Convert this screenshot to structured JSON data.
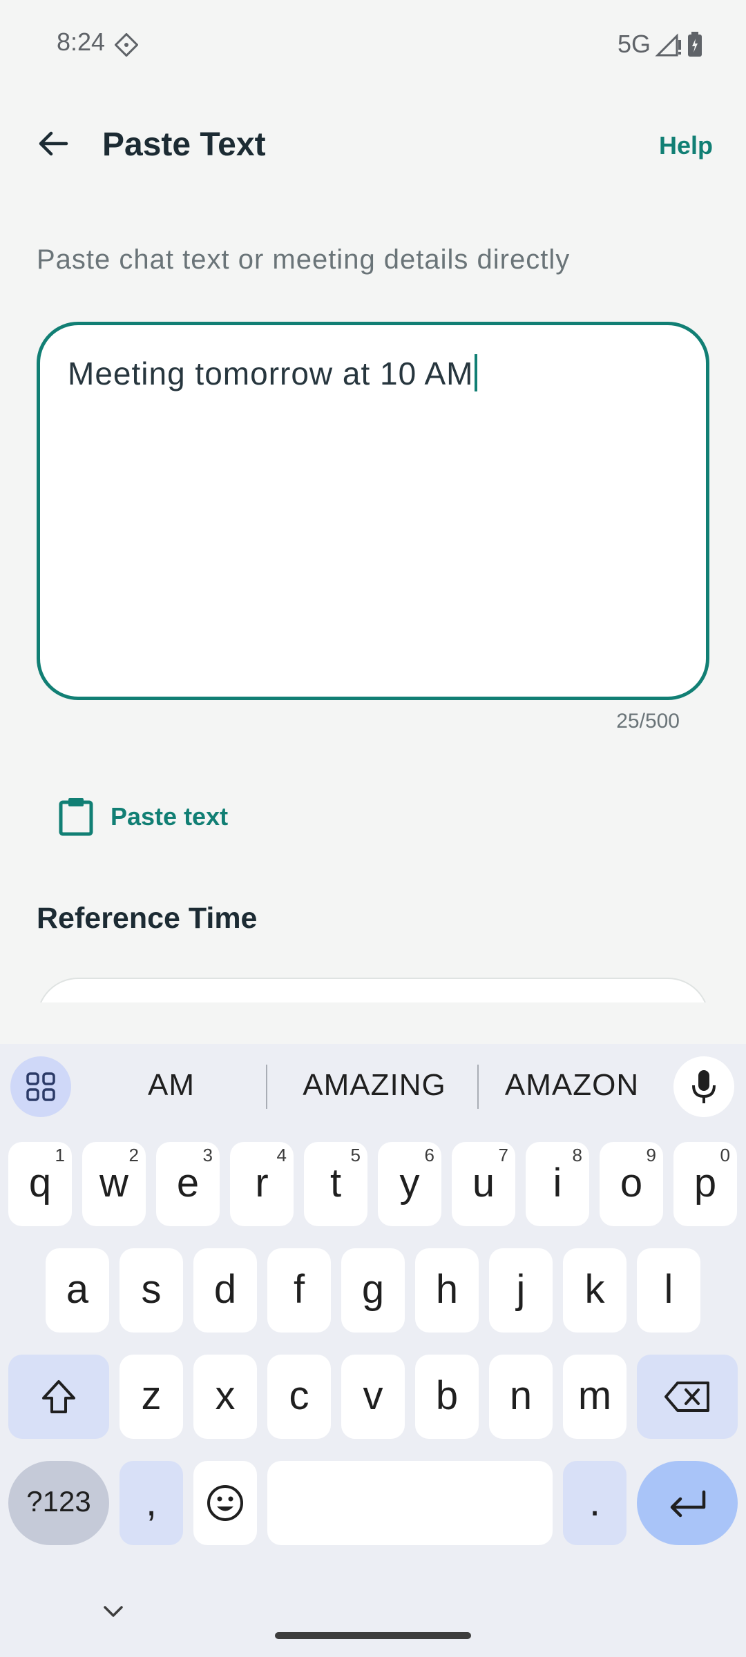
{
  "status_bar": {
    "time": "8:24",
    "network": "5G"
  },
  "app_bar": {
    "title": "Paste Text",
    "help_label": "Help"
  },
  "form": {
    "instruction": "Paste chat text or meeting details directly",
    "text_value": "Meeting tomorrow at 10 AM",
    "char_count": "25/500",
    "paste_button_label": "Paste text",
    "reference_heading": "Reference Time"
  },
  "keyboard": {
    "suggestions": [
      "AM",
      "AMAZING",
      "AMAZON"
    ],
    "row1": [
      {
        "key": "q",
        "hint": "1"
      },
      {
        "key": "w",
        "hint": "2"
      },
      {
        "key": "e",
        "hint": "3"
      },
      {
        "key": "r",
        "hint": "4"
      },
      {
        "key": "t",
        "hint": "5"
      },
      {
        "key": "y",
        "hint": "6"
      },
      {
        "key": "u",
        "hint": "7"
      },
      {
        "key": "i",
        "hint": "8"
      },
      {
        "key": "o",
        "hint": "9"
      },
      {
        "key": "p",
        "hint": "0"
      }
    ],
    "row2": [
      "a",
      "s",
      "d",
      "f",
      "g",
      "h",
      "j",
      "k",
      "l"
    ],
    "row3": [
      "z",
      "x",
      "c",
      "v",
      "b",
      "n",
      "m"
    ],
    "symbols_label": "?123",
    "comma": ",",
    "period": "."
  },
  "colors": {
    "accent": "#117f74",
    "keyboard_bg": "#eceef4",
    "function_key": "#d8e0f7",
    "enter_key": "#a9c4f8"
  }
}
